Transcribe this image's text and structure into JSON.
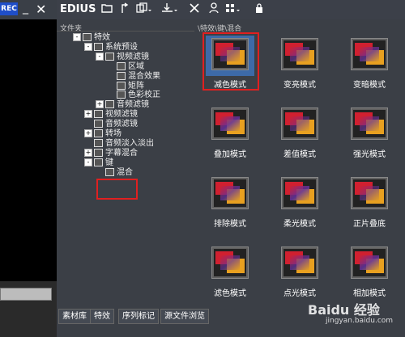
{
  "left_panel": {
    "rec_label": "REC",
    "minimize": "_",
    "close": "✕"
  },
  "toolbar": {
    "title": "EDIUS",
    "icons": [
      "folder-icon",
      "up-folder-icon",
      "copy-dropdown-icon",
      "import-dropdown-icon",
      "delete-icon",
      "properties-icon",
      "view-dropdown-icon",
      "lock-icon"
    ]
  },
  "folder_pane": {
    "header": "文件夹",
    "tree": [
      {
        "label": "特效",
        "indent": 0,
        "expander": "-"
      },
      {
        "label": "系统预设",
        "indent": 1,
        "expander": "-"
      },
      {
        "label": "视频滤镜",
        "indent": 2,
        "expander": "-"
      },
      {
        "label": "区域",
        "indent": 3,
        "expander": ""
      },
      {
        "label": "混合效果",
        "indent": 3,
        "expander": ""
      },
      {
        "label": "矩阵",
        "indent": 3,
        "expander": ""
      },
      {
        "label": "色彩校正",
        "indent": 3,
        "expander": ""
      },
      {
        "label": "音频滤镜",
        "indent": 2,
        "expander": "+"
      },
      {
        "label": "视频滤镜",
        "indent": 1,
        "expander": "+"
      },
      {
        "label": "音频滤镜",
        "indent": 1,
        "expander": ""
      },
      {
        "label": "转场",
        "indent": 1,
        "expander": "+"
      },
      {
        "label": "音频淡入淡出",
        "indent": 1,
        "expander": ""
      },
      {
        "label": "字幕混合",
        "indent": 1,
        "expander": "+"
      },
      {
        "label": "键",
        "indent": 1,
        "expander": "-"
      },
      {
        "label": "混合",
        "indent": 2,
        "expander": ""
      }
    ]
  },
  "grid_pane": {
    "path": "\\特效\\键\\混合",
    "effects": [
      {
        "label": "减色模式",
        "selected": true
      },
      {
        "label": "变亮模式",
        "selected": false
      },
      {
        "label": "变暗模式",
        "selected": false
      },
      {
        "label": "叠加模式",
        "selected": false
      },
      {
        "label": "差值模式",
        "selected": false
      },
      {
        "label": "强光模式",
        "selected": false
      },
      {
        "label": "排除模式",
        "selected": false
      },
      {
        "label": "柔光模式",
        "selected": false
      },
      {
        "label": "正片叠底",
        "selected": false
      },
      {
        "label": "滤色模式",
        "selected": false
      },
      {
        "label": "点光模式",
        "selected": false
      },
      {
        "label": "相加模式",
        "selected": false
      }
    ]
  },
  "bottom_tabs": [
    "素材库",
    "特效",
    "序列标记",
    "源文件浏览"
  ],
  "watermark": {
    "brand": "Baidu 经验",
    "url": "jingyan.baidu.com"
  },
  "colors": {
    "highlight": "#e02020",
    "selection": "#3d6aa8",
    "panel": "#3b3f46"
  }
}
